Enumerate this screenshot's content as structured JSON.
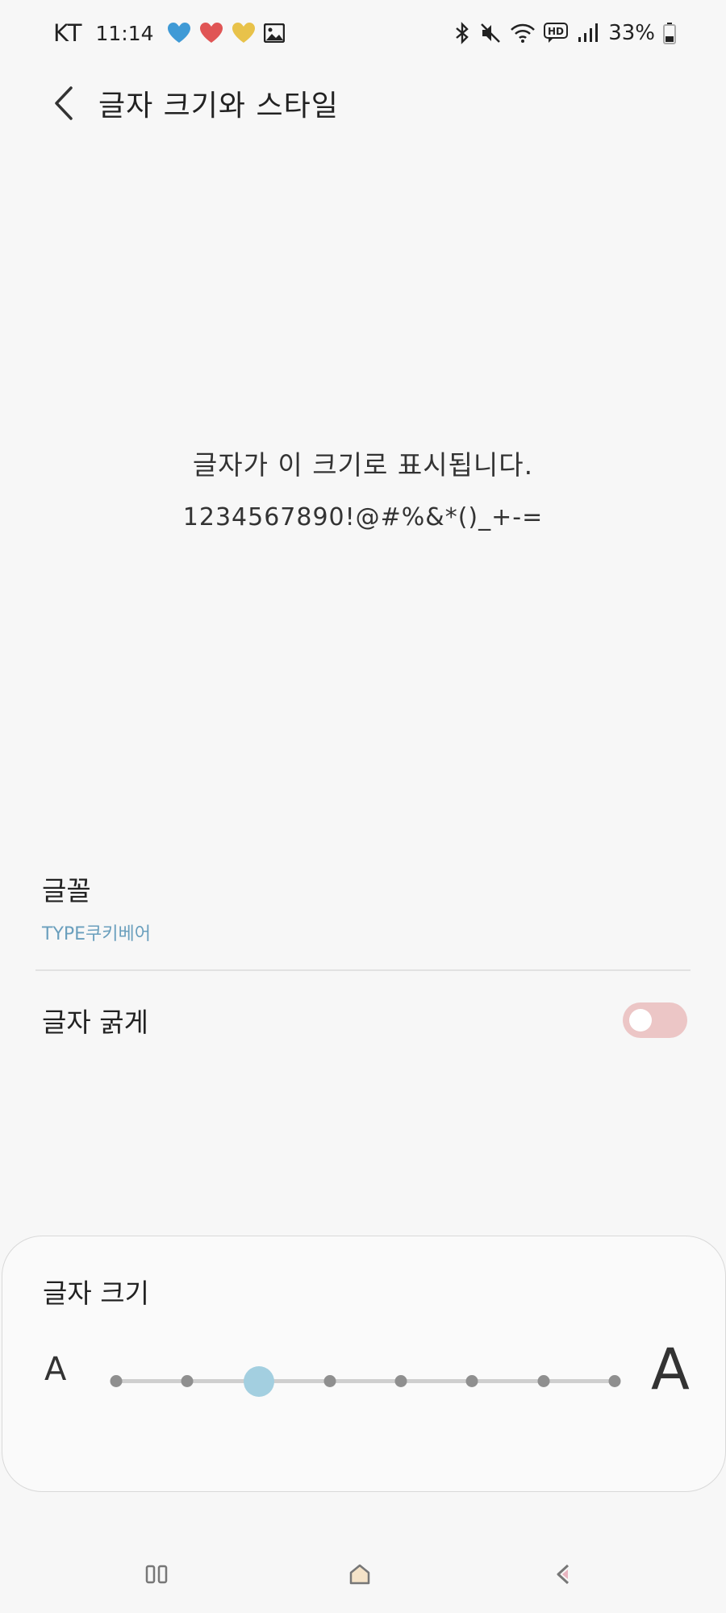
{
  "status_bar": {
    "carrier": "KT",
    "time": "11:14",
    "battery": "33%",
    "colors": {
      "blue_heart": "#3f9ad6",
      "red_heart": "#e05555",
      "yellow_heart": "#e8c24a"
    },
    "icons": [
      "blue-heart-icon",
      "red-heart-icon",
      "yellow-heart-icon",
      "gallery-icon",
      "bluetooth-icon",
      "mute-icon",
      "wifi-icon",
      "hd-voice-icon",
      "signal-icon",
      "battery-icon"
    ]
  },
  "header": {
    "title": "글자 크기와 스타일",
    "back_icon": "chevron-left-icon"
  },
  "preview": {
    "line1": "글자가 이 크기로 표시됩니다.",
    "line2": "1234567890!@#%&*()_+-="
  },
  "settings": {
    "font": {
      "label": "글꼴",
      "value": "TYPE쿠키베어"
    },
    "bold": {
      "label": "글자 굵게",
      "enabled": false
    }
  },
  "font_size": {
    "title": "글자 크기",
    "small_label": "A",
    "large_label": "A",
    "levels": 8,
    "selected_level": 3,
    "thumb_color": "#a3cfe0"
  },
  "nav": {
    "icons": [
      "recent-apps-icon",
      "home-icon",
      "back-icon"
    ]
  }
}
